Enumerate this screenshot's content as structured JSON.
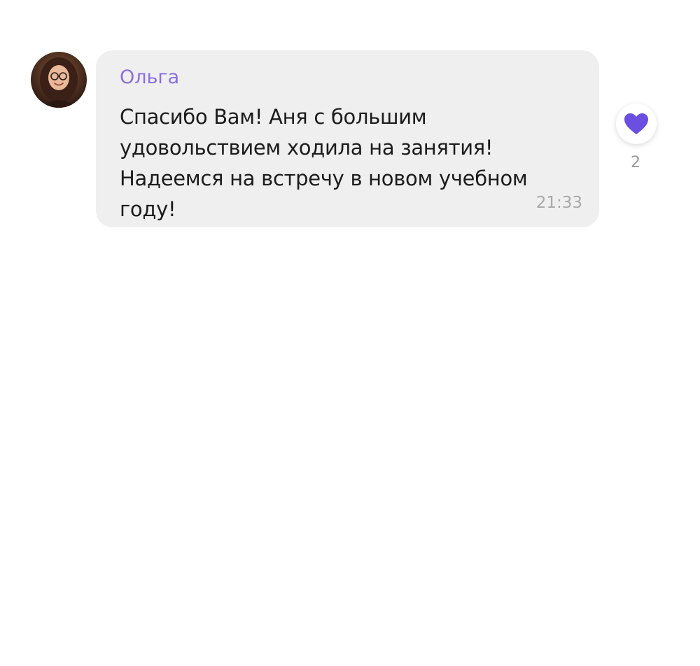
{
  "message": {
    "sender": "Ольга",
    "text": "Спасибо Вам! Аня с большим удовольствием ходила на занятия! Надеемся на встречу в новом учебном году!",
    "time": "21:33"
  },
  "reaction": {
    "icon": "heart-icon",
    "count": "2"
  },
  "colors": {
    "sender_name": "#8a6fe0",
    "bubble_bg": "#efefef",
    "heart": "#6a4fe0",
    "timestamp": "#a9a9a9"
  }
}
